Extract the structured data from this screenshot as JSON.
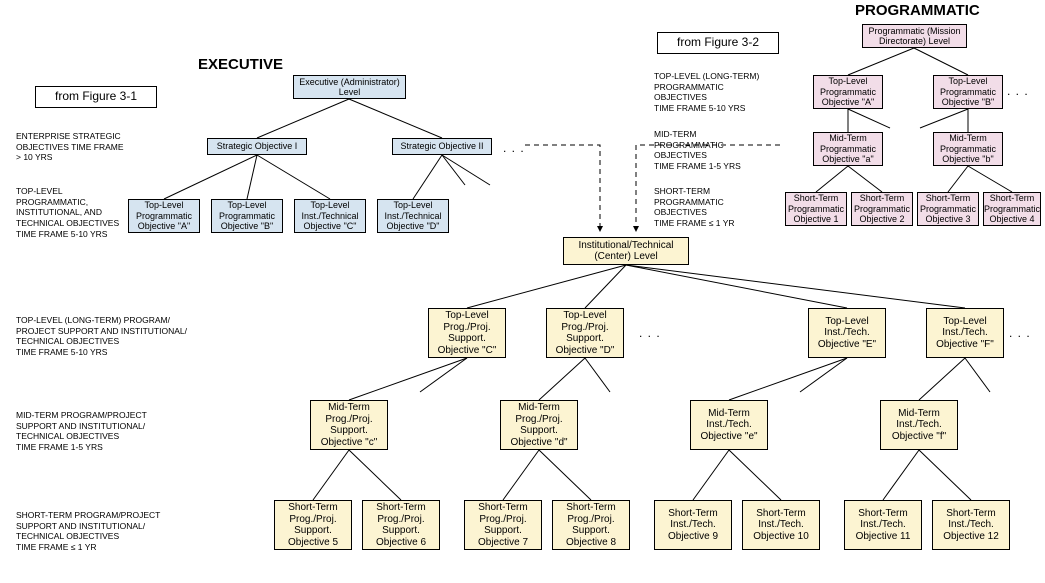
{
  "headings": {
    "executive": "EXECUTIVE",
    "programmatic": "PROGRAMMATIC"
  },
  "fromBoxes": {
    "fig31": "from  Figure 3-1",
    "fig32": "from  Figure 3-2"
  },
  "labels": {
    "enterprise": "ENTERPRISE STRATEGIC\nOBJECTIVES TIME FRAME\n> 10 YRS",
    "topLevelExec": "TOP-LEVEL\nPROGRAMMATIC,\nINSTITUTIONAL, AND\nTECHNICAL OBJECTIVES\nTIME FRAME 5-10 YRS",
    "progTopLevel": "TOP-LEVEL (LONG-TERM)\nPROGRAMMATIC\nOBJECTIVES\nTIME FRAME 5-10 YRS",
    "progMidTerm": "MID-TERM\nPROGRAMMATIC\nOBJECTIVES\nTIME FRAME 1-5 YRS",
    "progShortTerm": "SHORT-TERM\nPROGRAMMATIC\nOBJECTIVES\nTIME FRAME ≤ 1 YR",
    "centerTopLevel": "TOP-LEVEL (LONG-TERM) PROGRAM/\nPROJECT SUPPORT AND INSTITUTIONAL/\nTECHNICAL OBJECTIVES\nTIME FRAME 5-10 YRS",
    "centerMidTerm": "MID-TERM PROGRAM/PROJECT\nSUPPORT AND INSTITUTIONAL/\nTECHNICAL OBJECTIVES\nTIME FRAME 1-5 YRS",
    "centerShortTerm": "SHORT-TERM PROGRAM/PROJECT\nSUPPORT AND INSTITUTIONAL/\nTECHNICAL OBJECTIVES\nTIME FRAME ≤ 1 YR"
  },
  "exec": {
    "root": "Executive (Administrator)\nLevel",
    "so1": "Strategic Objective I",
    "so2": "Strategic Objective II",
    "tlpA": "Top-Level\nProgrammatic\nObjective \"A\"",
    "tlpB": "Top-Level\nProgrammatic\nObjective \"B\"",
    "tliC": "Top-Level\nInst./Technical\nObjective \"C\"",
    "tliD": "Top-Level\nInst./Technical\nObjective \"D\""
  },
  "prog": {
    "root": "Programmatic (Mission\nDirectorate) Level",
    "tlpA": "Top-Level\nProgrammatic\nObjective \"A\"",
    "tlpB": "Top-Level\nProgrammatic\nObjective \"B\"",
    "mta": "Mid-Term\nProgrammatic\nObjective \"a\"",
    "mtb": "Mid-Term\nProgrammatic\nObjective \"b\"",
    "st1": "Short-Term\nProgrammatic\nObjective 1",
    "st2": "Short-Term\nProgrammatic\nObjective 2",
    "st3": "Short-Term\nProgrammatic\nObjective 3",
    "st4": "Short-Term\nProgrammatic\nObjective 4"
  },
  "center": {
    "root": "Institutional/Technical\n(Center) Level",
    "tlC": "Top-Level\nProg./Proj.\nSupport.\nObjective \"C\"",
    "tlD": "Top-Level\nProg./Proj.\nSupport.\nObjective \"D\"",
    "tlE": "Top-Level\nInst./Tech.\nObjective \"E\"",
    "tlF": "Top-Level\nInst./Tech.\nObjective \"F\"",
    "mtc": "Mid-Term\nProg./Proj.\nSupport.\nObjective \"c\"",
    "mtd": "Mid-Term\nProg./Proj.\nSupport.\nObjective \"d\"",
    "mte": "Mid-Term\nInst./Tech.\nObjective \"e\"",
    "mtf": "Mid-Term\nInst./Tech.\nObjective \"f\"",
    "st5": "Short-Term\nProg./Proj.\nSupport.\nObjective 5",
    "st6": "Short-Term\nProg./Proj.\nSupport.\nObjective 6",
    "st7": "Short-Term\nProg./Proj.\nSupport.\nObjective 7",
    "st8": "Short-Term\nProg./Proj.\nSupport.\nObjective 8",
    "st9": "Short-Term\nInst./Tech.\nObjective 9",
    "st10": "Short-Term\nInst./Tech.\nObjective 10",
    "st11": "Short-Term\nInst./Tech.\nObjective 11",
    "st12": "Short-Term\nInst./Tech.\nObjective 12"
  },
  "dots": ". . ."
}
